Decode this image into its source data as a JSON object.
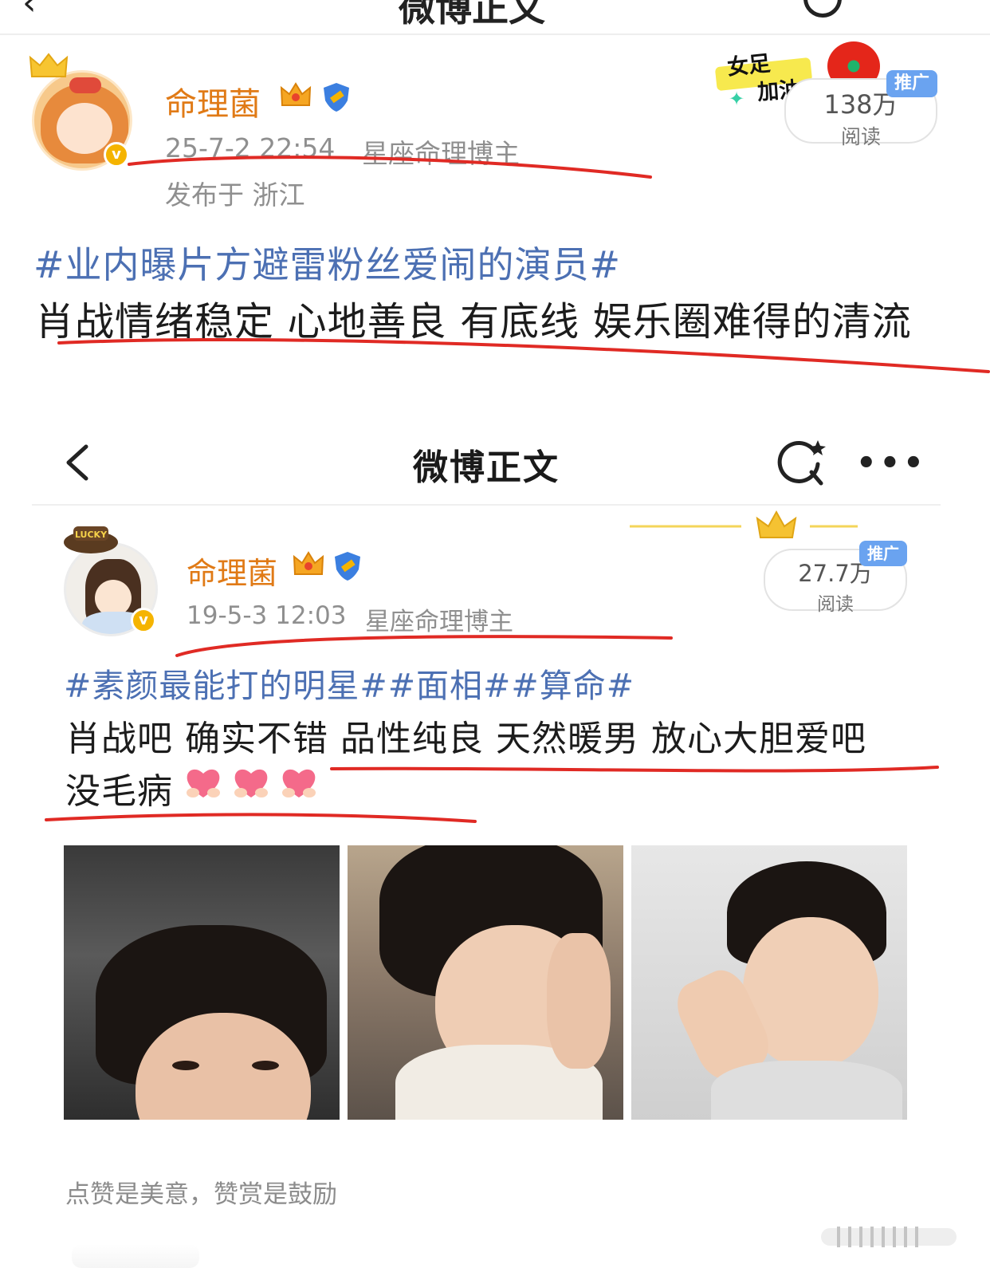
{
  "top_nav": {
    "title": "微博正文"
  },
  "post1": {
    "author": "命理菌",
    "timestamp": "25-7-2 22:54",
    "role": "星座命理博主",
    "location": "发布于 浙江",
    "reads_value": "138万",
    "reads_label": "阅读",
    "promo": "推广",
    "sticker_text_1": "女足",
    "sticker_text_2": "加油",
    "hashtag": "#业内曝片方避雷粉丝爱闹的演员#",
    "body": "肖战情绪稳定 心地善良 有底线 娱乐圈难得的清流"
  },
  "screenshot_nav": {
    "title": "微博正文"
  },
  "post2": {
    "author": "命理菌",
    "timestamp": "19-5-3 12:03",
    "role": "星座命理博主",
    "reads_value": "27.7万",
    "reads_label": "阅读",
    "promo": "推广",
    "avatar_badge": "LUCKY",
    "hashtags": "#素颜最能打的明星##面相##算命#",
    "body_line1": "肖战吧 确实不错 品性纯良 天然暖男 放心大胆爱吧",
    "body_line2": "没毛病",
    "heart_emoji_count": 3,
    "photo_count": 3
  },
  "footer": {
    "reward_text": "点赞是美意，赞赏是鼓励"
  },
  "colors": {
    "name_orange": "#e07a16",
    "hashtag_blue": "#4c70b3",
    "annotation_red": "#e02a24",
    "promo_blue": "#6aa3f0",
    "verified_gold": "#f5b400",
    "meta_gray": "#8f8f8f"
  }
}
